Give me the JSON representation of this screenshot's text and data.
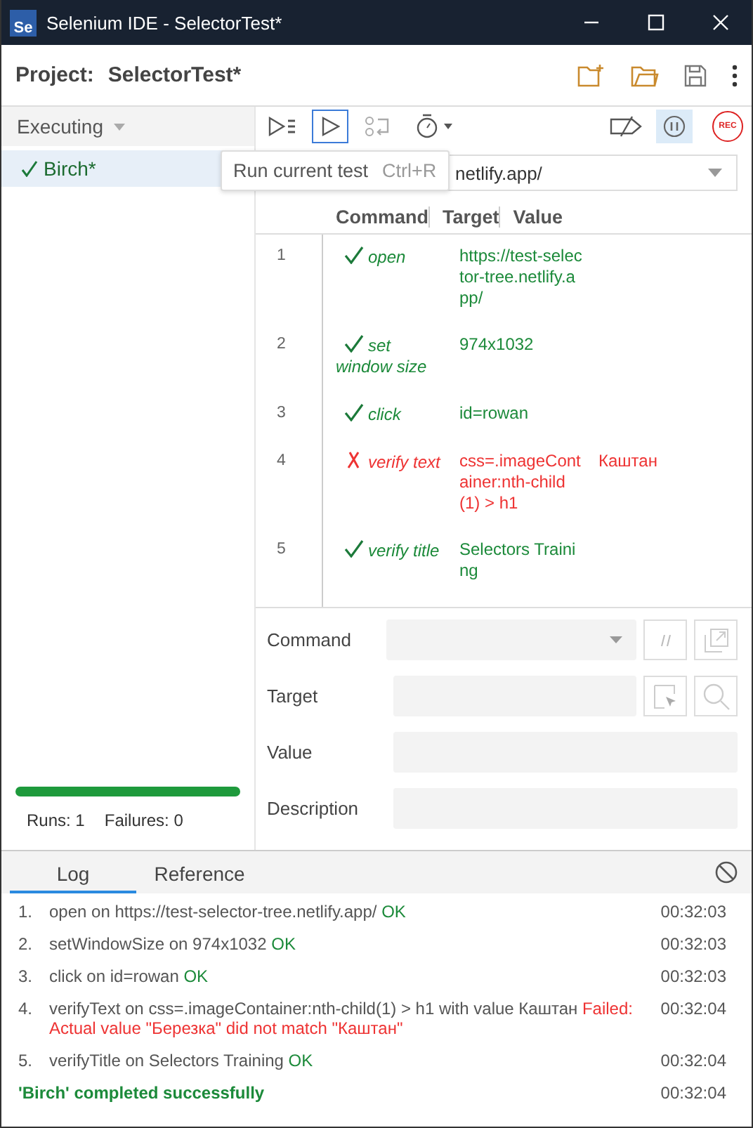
{
  "window": {
    "logo": "Se",
    "title": "Selenium IDE - SelectorTest*"
  },
  "project": {
    "label": "Project:",
    "name": "SelectorTest*"
  },
  "sidebar": {
    "mode": "Executing",
    "tests": [
      {
        "name": "Birch*",
        "passed": true,
        "selected": true
      }
    ],
    "progress": {
      "level": 1
    },
    "runs_label": "Runs: 1",
    "failures_label": "Failures: 0"
  },
  "toolbar": {
    "run_current_selected": true,
    "pause_active": true,
    "rec": "REC",
    "tooltip": {
      "text": "Run current test",
      "shortcut": "Ctrl+R"
    }
  },
  "url": {
    "value": "netlify.app/"
  },
  "table": {
    "columns": [
      "Command",
      "Target",
      "Value"
    ],
    "rows": [
      {
        "number": "1",
        "passed": true,
        "command": "open",
        "target": "https://test-selector-tree.netlify.app/"
      },
      {
        "number": "2",
        "passed": true,
        "command": "set window size",
        "target": "974x1032"
      },
      {
        "number": "3",
        "passed": true,
        "command": "click",
        "target": "id=rowan"
      },
      {
        "number": "4",
        "passed": false,
        "command": "verify text",
        "target": "css=.imageContainer:nth-child(1) > h1",
        "value": "Каштан"
      },
      {
        "number": "5",
        "passed": true,
        "command": "verify title",
        "target": "Selectors Training"
      }
    ]
  },
  "editor": {
    "fields": [
      "Command",
      "Target",
      "Value",
      "Description"
    ]
  },
  "log": {
    "tabs": [
      {
        "label": "Log",
        "selected": true
      },
      {
        "label": "Reference",
        "selected": false
      }
    ],
    "entries": [
      {
        "kind": "step",
        "number": "1.",
        "text": "open on https://test-selector-tree.netlify.app/",
        "result": "OK",
        "time": "00:32:03"
      },
      {
        "kind": "step",
        "number": "2.",
        "text": "setWindowSize on 974x1032",
        "result": "OK",
        "time": "00:32:03"
      },
      {
        "kind": "step",
        "number": "3.",
        "text": "click on id=rowan",
        "result": "OK",
        "time": "00:32:03"
      },
      {
        "kind": "failed",
        "number": "4.",
        "text": "verifyText on css=.imageContainer:nth-child(1) > h1 with value Каштан",
        "result": "Failed:",
        "detail": "Actual value \"Березка\" did not match \"Каштан\"",
        "time": "00:32:04"
      },
      {
        "kind": "step",
        "number": "5.",
        "text": "verifyTitle on Selectors Training",
        "result": "OK",
        "time": "00:32:04"
      },
      {
        "kind": "summary",
        "text": "'Birch' completed successfully",
        "time": "00:32:04"
      }
    ]
  }
}
